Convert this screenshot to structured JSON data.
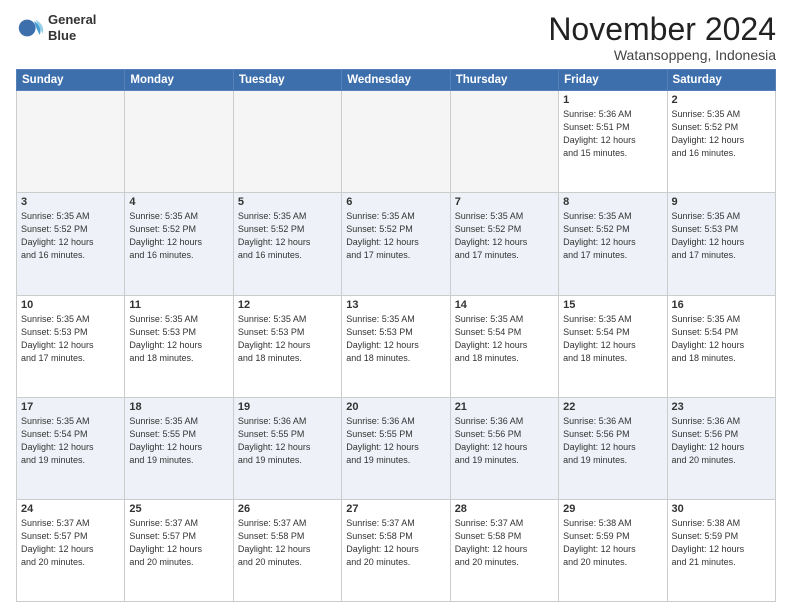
{
  "logo": {
    "line1": "General",
    "line2": "Blue"
  },
  "header": {
    "month": "November 2024",
    "location": "Watansoppeng, Indonesia"
  },
  "weekdays": [
    "Sunday",
    "Monday",
    "Tuesday",
    "Wednesday",
    "Thursday",
    "Friday",
    "Saturday"
  ],
  "weeks": [
    [
      {
        "day": "",
        "info": ""
      },
      {
        "day": "",
        "info": ""
      },
      {
        "day": "",
        "info": ""
      },
      {
        "day": "",
        "info": ""
      },
      {
        "day": "",
        "info": ""
      },
      {
        "day": "1",
        "info": "Sunrise: 5:36 AM\nSunset: 5:51 PM\nDaylight: 12 hours\nand 15 minutes."
      },
      {
        "day": "2",
        "info": "Sunrise: 5:35 AM\nSunset: 5:52 PM\nDaylight: 12 hours\nand 16 minutes."
      }
    ],
    [
      {
        "day": "3",
        "info": "Sunrise: 5:35 AM\nSunset: 5:52 PM\nDaylight: 12 hours\nand 16 minutes."
      },
      {
        "day": "4",
        "info": "Sunrise: 5:35 AM\nSunset: 5:52 PM\nDaylight: 12 hours\nand 16 minutes."
      },
      {
        "day": "5",
        "info": "Sunrise: 5:35 AM\nSunset: 5:52 PM\nDaylight: 12 hours\nand 16 minutes."
      },
      {
        "day": "6",
        "info": "Sunrise: 5:35 AM\nSunset: 5:52 PM\nDaylight: 12 hours\nand 17 minutes."
      },
      {
        "day": "7",
        "info": "Sunrise: 5:35 AM\nSunset: 5:52 PM\nDaylight: 12 hours\nand 17 minutes."
      },
      {
        "day": "8",
        "info": "Sunrise: 5:35 AM\nSunset: 5:52 PM\nDaylight: 12 hours\nand 17 minutes."
      },
      {
        "day": "9",
        "info": "Sunrise: 5:35 AM\nSunset: 5:53 PM\nDaylight: 12 hours\nand 17 minutes."
      }
    ],
    [
      {
        "day": "10",
        "info": "Sunrise: 5:35 AM\nSunset: 5:53 PM\nDaylight: 12 hours\nand 17 minutes."
      },
      {
        "day": "11",
        "info": "Sunrise: 5:35 AM\nSunset: 5:53 PM\nDaylight: 12 hours\nand 18 minutes."
      },
      {
        "day": "12",
        "info": "Sunrise: 5:35 AM\nSunset: 5:53 PM\nDaylight: 12 hours\nand 18 minutes."
      },
      {
        "day": "13",
        "info": "Sunrise: 5:35 AM\nSunset: 5:53 PM\nDaylight: 12 hours\nand 18 minutes."
      },
      {
        "day": "14",
        "info": "Sunrise: 5:35 AM\nSunset: 5:54 PM\nDaylight: 12 hours\nand 18 minutes."
      },
      {
        "day": "15",
        "info": "Sunrise: 5:35 AM\nSunset: 5:54 PM\nDaylight: 12 hours\nand 18 minutes."
      },
      {
        "day": "16",
        "info": "Sunrise: 5:35 AM\nSunset: 5:54 PM\nDaylight: 12 hours\nand 18 minutes."
      }
    ],
    [
      {
        "day": "17",
        "info": "Sunrise: 5:35 AM\nSunset: 5:54 PM\nDaylight: 12 hours\nand 19 minutes."
      },
      {
        "day": "18",
        "info": "Sunrise: 5:35 AM\nSunset: 5:55 PM\nDaylight: 12 hours\nand 19 minutes."
      },
      {
        "day": "19",
        "info": "Sunrise: 5:36 AM\nSunset: 5:55 PM\nDaylight: 12 hours\nand 19 minutes."
      },
      {
        "day": "20",
        "info": "Sunrise: 5:36 AM\nSunset: 5:55 PM\nDaylight: 12 hours\nand 19 minutes."
      },
      {
        "day": "21",
        "info": "Sunrise: 5:36 AM\nSunset: 5:56 PM\nDaylight: 12 hours\nand 19 minutes."
      },
      {
        "day": "22",
        "info": "Sunrise: 5:36 AM\nSunset: 5:56 PM\nDaylight: 12 hours\nand 19 minutes."
      },
      {
        "day": "23",
        "info": "Sunrise: 5:36 AM\nSunset: 5:56 PM\nDaylight: 12 hours\nand 20 minutes."
      }
    ],
    [
      {
        "day": "24",
        "info": "Sunrise: 5:37 AM\nSunset: 5:57 PM\nDaylight: 12 hours\nand 20 minutes."
      },
      {
        "day": "25",
        "info": "Sunrise: 5:37 AM\nSunset: 5:57 PM\nDaylight: 12 hours\nand 20 minutes."
      },
      {
        "day": "26",
        "info": "Sunrise: 5:37 AM\nSunset: 5:58 PM\nDaylight: 12 hours\nand 20 minutes."
      },
      {
        "day": "27",
        "info": "Sunrise: 5:37 AM\nSunset: 5:58 PM\nDaylight: 12 hours\nand 20 minutes."
      },
      {
        "day": "28",
        "info": "Sunrise: 5:37 AM\nSunset: 5:58 PM\nDaylight: 12 hours\nand 20 minutes."
      },
      {
        "day": "29",
        "info": "Sunrise: 5:38 AM\nSunset: 5:59 PM\nDaylight: 12 hours\nand 20 minutes."
      },
      {
        "day": "30",
        "info": "Sunrise: 5:38 AM\nSunset: 5:59 PM\nDaylight: 12 hours\nand 21 minutes."
      }
    ]
  ]
}
